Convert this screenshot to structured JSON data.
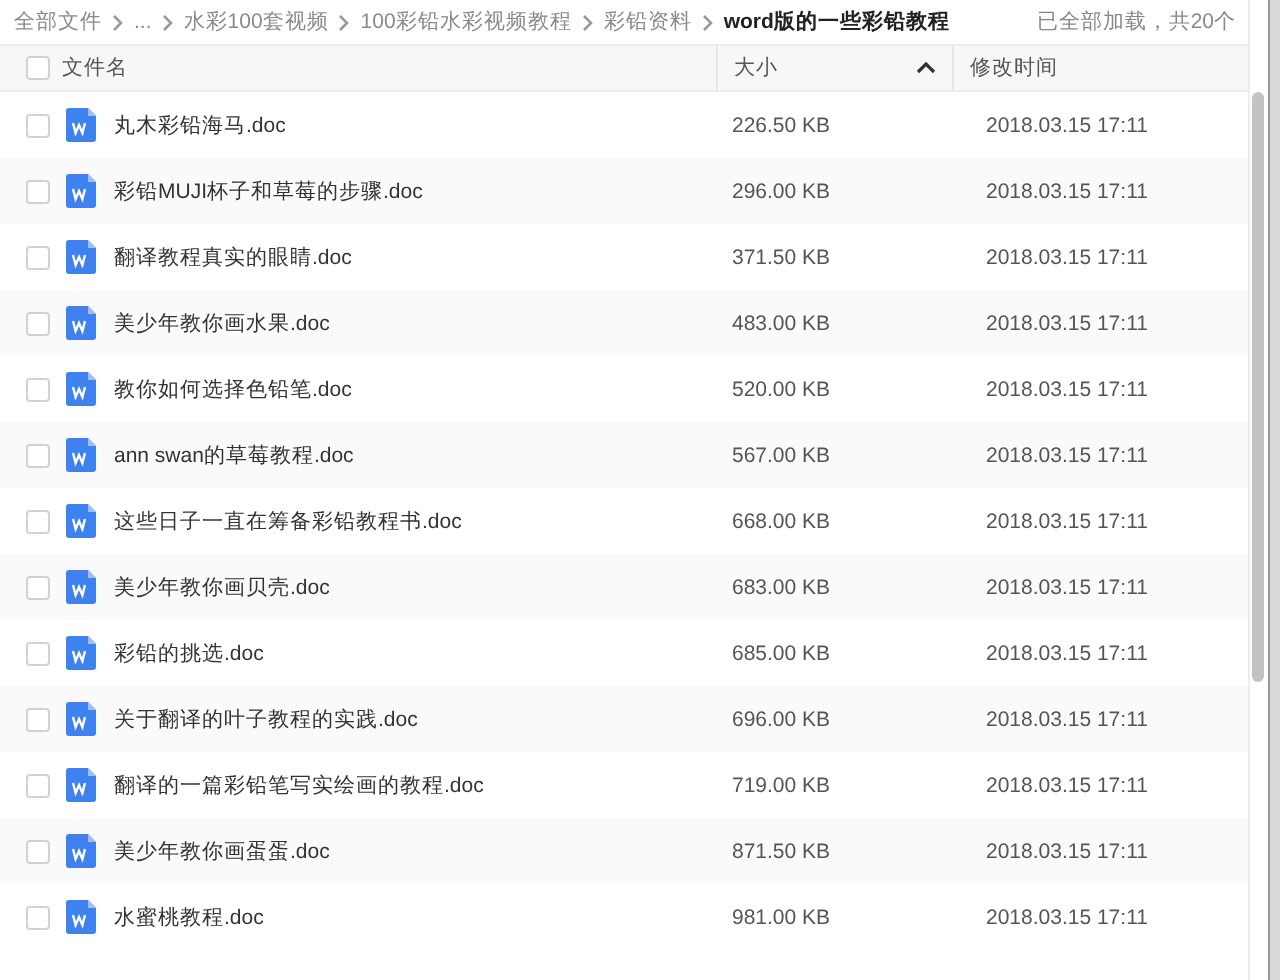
{
  "breadcrumb": {
    "items": [
      {
        "label": "全部文件",
        "current": false
      },
      {
        "label": "...",
        "current": false
      },
      {
        "label": "水彩100套视频",
        "current": false
      },
      {
        "label": "100彩铅水彩视频教程",
        "current": false
      },
      {
        "label": "彩铅资料",
        "current": false
      },
      {
        "label": "word版的一些彩铅教程",
        "current": true
      }
    ],
    "status": "已全部加载，共20个"
  },
  "table": {
    "select_all": {
      "checked": false
    },
    "columns": [
      {
        "label": "文件名",
        "sorted": false
      },
      {
        "label": "大小",
        "sorted": true
      },
      {
        "label": "修改时间",
        "sorted": false
      }
    ],
    "rows": [
      {
        "name": "丸木彩铅海马.doc",
        "size": "226.50 KB",
        "modified": "2018.03.15 17:11",
        "checked": false
      },
      {
        "name": "彩铅MUJI杯子和草莓的步骤.doc",
        "size": "296.00 KB",
        "modified": "2018.03.15 17:11",
        "checked": false
      },
      {
        "name": "翻译教程真实的眼睛.doc",
        "size": "371.50 KB",
        "modified": "2018.03.15 17:11",
        "checked": false
      },
      {
        "name": "美少年教你画水果.doc",
        "size": "483.00 KB",
        "modified": "2018.03.15 17:11",
        "checked": false
      },
      {
        "name": "教你如何选择色铅笔.doc",
        "size": "520.00 KB",
        "modified": "2018.03.15 17:11",
        "checked": false
      },
      {
        "name": "ann swan的草莓教程.doc",
        "size": "567.00 KB",
        "modified": "2018.03.15 17:11",
        "checked": false
      },
      {
        "name": "这些日子一直在筹备彩铅教程书.doc",
        "size": "668.00 KB",
        "modified": "2018.03.15 17:11",
        "checked": false
      },
      {
        "name": "美少年教你画贝壳.doc",
        "size": "683.00 KB",
        "modified": "2018.03.15 17:11",
        "checked": false
      },
      {
        "name": "彩铅的挑选.doc",
        "size": "685.00 KB",
        "modified": "2018.03.15 17:11",
        "checked": false
      },
      {
        "name": "关于翻译的叶子教程的实践.doc",
        "size": "696.00 KB",
        "modified": "2018.03.15 17:11",
        "checked": false
      },
      {
        "name": "翻译的一篇彩铅笔写实绘画的教程.doc",
        "size": "719.00 KB",
        "modified": "2018.03.15 17:11",
        "checked": false
      },
      {
        "name": "美少年教你画蛋蛋.doc",
        "size": "871.50 KB",
        "modified": "2018.03.15 17:11",
        "checked": false
      },
      {
        "name": "水蜜桃教程.doc",
        "size": "981.00 KB",
        "modified": "2018.03.15 17:11",
        "checked": false
      }
    ]
  }
}
